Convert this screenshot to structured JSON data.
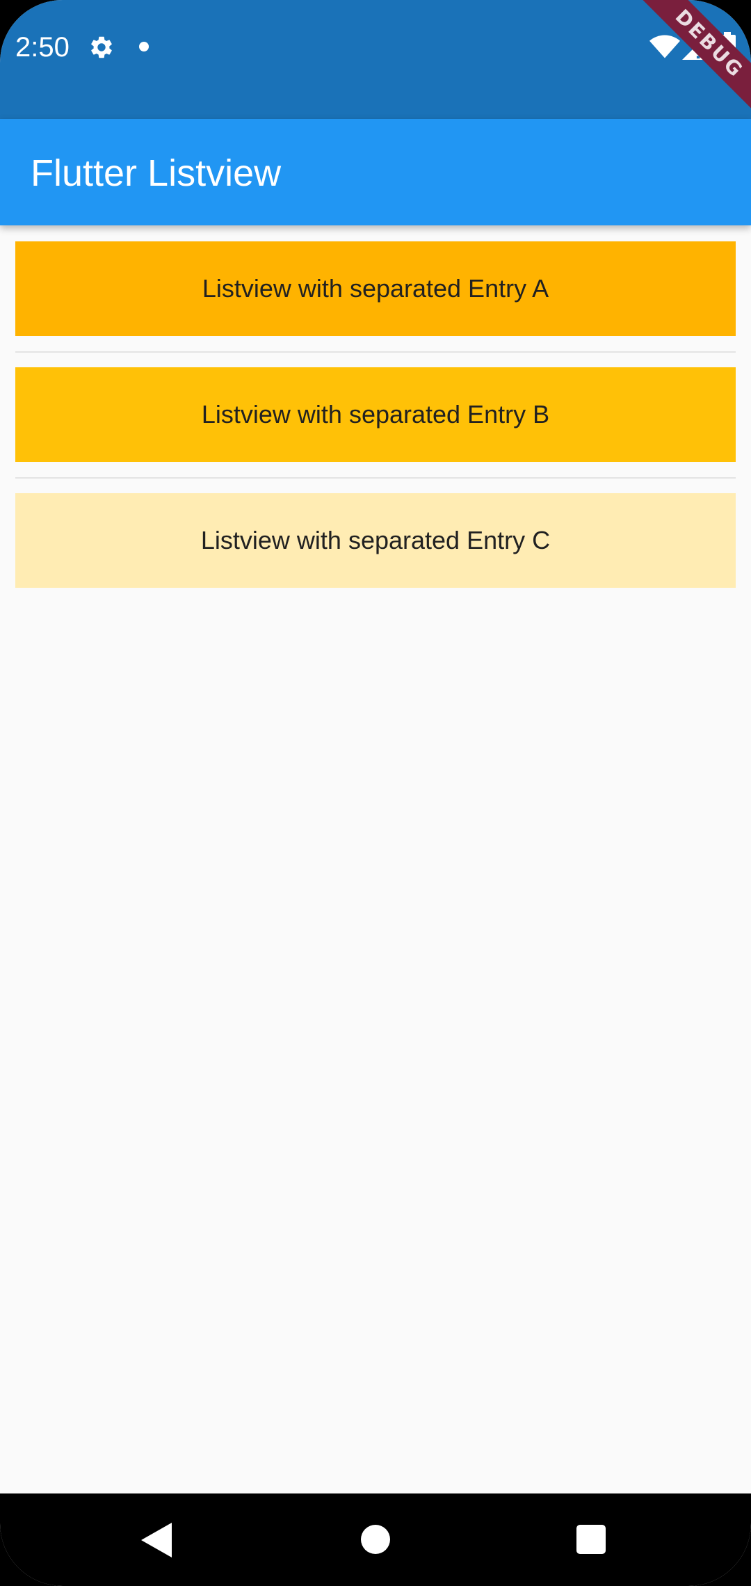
{
  "status_bar": {
    "time": "2:50",
    "icons": [
      "settings-icon",
      "notification-dot-icon",
      "wifi-icon",
      "signal-icon",
      "battery-icon"
    ]
  },
  "debug_banner": {
    "label": "DEBUG",
    "color": "#7a1f3d"
  },
  "app_bar": {
    "title": "Flutter Listview",
    "color": "#2196f3"
  },
  "list": {
    "entries": [
      {
        "label": "Listview with separated Entry A",
        "color": "#ffb300"
      },
      {
        "label": "Listview with separated Entry B",
        "color": "#ffc107"
      },
      {
        "label": "Listview with separated Entry C",
        "color": "#ffecb3"
      }
    ]
  },
  "nav_bar": {
    "icons": [
      "back-icon",
      "home-icon",
      "recents-icon"
    ]
  }
}
